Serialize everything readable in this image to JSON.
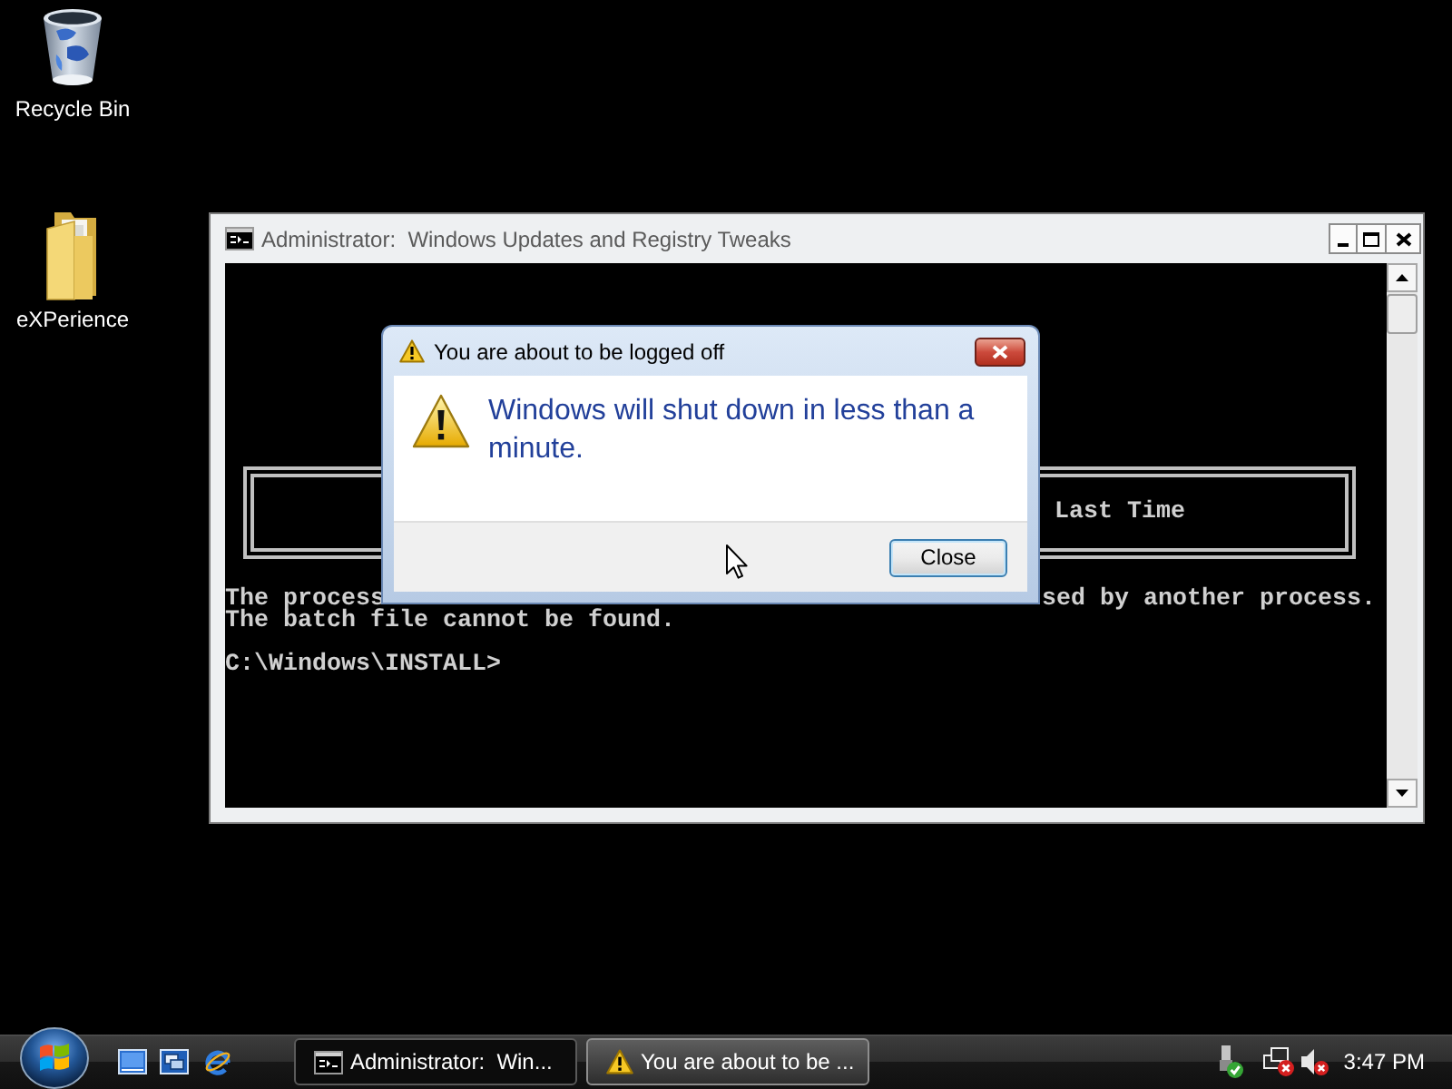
{
  "desktop_icons": [
    {
      "label": "Recycle Bin",
      "kind": "recycle_bin"
    },
    {
      "label": "eXPerience",
      "kind": "folder"
    }
  ],
  "console_window": {
    "title": "Administrator:  Windows Updates and Registry Tweaks",
    "banner_text": "Last Time",
    "output_lines": [
      {
        "segments": [
          "The process",
          "sed by another process."
        ]
      },
      {
        "segments": [
          "The batch file cannot be found."
        ]
      }
    ],
    "prompt": "C:\\Windows\\INSTALL>"
  },
  "dialog": {
    "title": "You are about to be logged off",
    "message": "Windows will shut down in less than a minute.",
    "buttons": [
      "Close"
    ]
  },
  "taskbar": {
    "buttons": [
      {
        "label": "Administrator:  Win...",
        "kind": "console",
        "selected": false
      },
      {
        "label": "You are about to be ...",
        "kind": "warning",
        "selected": true
      }
    ],
    "clock": "3:47 PM"
  }
}
